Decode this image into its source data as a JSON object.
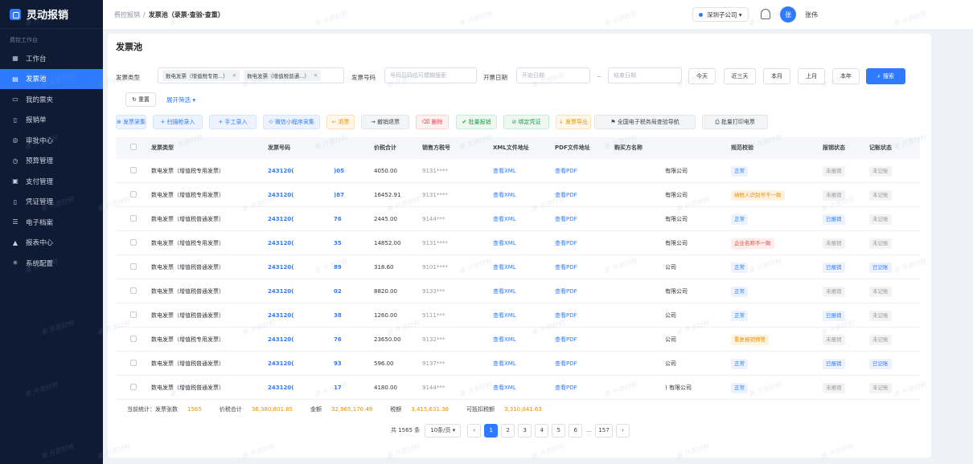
{
  "sidebar": {
    "brand": "灵动报销",
    "section": "费控工作台",
    "items": [
      {
        "icon": "▦",
        "label": "工作台"
      },
      {
        "icon": "▤",
        "label": "发票池"
      },
      {
        "icon": "▭",
        "label": "我的票夹"
      },
      {
        "icon": "▯",
        "label": "报销单"
      },
      {
        "icon": "◎",
        "label": "审批中心"
      },
      {
        "icon": "◷",
        "label": "预算管理"
      },
      {
        "icon": "▣",
        "label": "支付管理"
      },
      {
        "icon": "▯",
        "label": "凭证管理"
      },
      {
        "icon": "☰",
        "label": "电子档案"
      },
      {
        "icon": "▲",
        "label": "报表中心"
      },
      {
        "icon": "✳",
        "label": "系统配置"
      }
    ]
  },
  "header": {
    "crumb_root": "费控报销",
    "crumb_current": "发票池（录票·查验·查重）",
    "company": "深圳子公司 ▾",
    "avatar": "张",
    "user": "张伟"
  },
  "page": {
    "title": "发票池"
  },
  "filters": {
    "type_label": "发票类型",
    "type_tags": [
      "数电发票（增值税专用...）",
      "数电发票（增值税普通...）"
    ],
    "number_label": "发票号码",
    "number_placeholder": "号码后四位可模糊搜索",
    "date_label": "开票日期",
    "date_start": "开始日期",
    "date_sep": "~",
    "date_end": "结束日期",
    "quick": [
      "今天",
      "近三天",
      "本月",
      "上月",
      "本年"
    ],
    "search": "搜索",
    "reset": "重置",
    "expand": "展开筛选 ▾"
  },
  "toolbar": [
    {
      "label": "⊕ 发票采集",
      "style": "blue"
    },
    {
      "label": "+ 扫描枪录入",
      "style": "blue"
    },
    {
      "label": "+ 手工录入",
      "style": "blue"
    },
    {
      "label": "⟐ 微信小程序采集",
      "style": "blue"
    },
    {
      "label": "← 退票",
      "style": "orange"
    },
    {
      "label": "→ 撤销退票",
      "style": "gray"
    },
    {
      "label": "⌫ 删除",
      "style": "red"
    },
    {
      "label": "✔ 批量报销",
      "style": "green"
    },
    {
      "label": "⊘ 绑定凭证",
      "style": "green"
    },
    {
      "label": "↓ 发票导出",
      "style": "orange"
    },
    {
      "label": "⚑ 全国电子税务局查验导航",
      "style": "gray"
    },
    {
      "label": "⎙ 批量打印电票",
      "style": "gray"
    }
  ],
  "table": {
    "headers": [
      "发票类型",
      "发票号码",
      "价税合计",
      "销售方税号",
      "XML文件地址",
      "PDF文件地址",
      "购买方名称",
      "规范校验",
      "报销状态",
      "记账状态"
    ],
    "rows": [
      {
        "type": "数电发票（增值税专用发票）",
        "no_a": "243120(",
        "no_b": ")05",
        "amount": "4050.00",
        "tax_id": "9131****",
        "xml": "查看XML",
        "pdf": "查看PDF",
        "buyer": "有限公司",
        "check": "正常",
        "check_style": "blue",
        "reimb": "未报销",
        "reimb_style": "gray",
        "book": "未记账",
        "book_style": "gray"
      },
      {
        "type": "数电发票（增值税专用发票）",
        "no_a": "243120(",
        "no_b": ")87",
        "amount": "16452.91",
        "tax_id": "9131****",
        "xml": "查看XML",
        "pdf": "查看PDF",
        "buyer": "有限公司",
        "check": "纳税人识别号不一致",
        "check_style": "orange",
        "reimb": "未报销",
        "reimb_style": "gray",
        "book": "未记账",
        "book_style": "gray"
      },
      {
        "type": "数电发票（增值税普通发票）",
        "no_a": "243120(",
        "no_b": "76",
        "amount": "2445.00",
        "tax_id": "9144***",
        "xml": "查看XML",
        "pdf": "查看PDF",
        "buyer": "有限公司",
        "check": "正常",
        "check_style": "blue",
        "reimb": "已报销",
        "reimb_style": "blue",
        "book": "未记账",
        "book_style": "gray"
      },
      {
        "type": "数电发票（增值税专用发票）",
        "no_a": "243120(",
        "no_b": "35",
        "amount": "14852.00",
        "tax_id": "9131****",
        "xml": "查看XML",
        "pdf": "查看PDF",
        "buyer": "有限公司",
        "check": "企业名称不一致",
        "check_style": "red",
        "reimb": "未报销",
        "reimb_style": "gray",
        "book": "未记账",
        "book_style": "gray"
      },
      {
        "type": "数电发票（增值税普通发票）",
        "no_a": "243120(",
        "no_b": "89",
        "amount": "318.60",
        "tax_id": "9101****",
        "xml": "查看XML",
        "pdf": "查看PDF",
        "buyer": "公司",
        "check": "正常",
        "check_style": "blue",
        "reimb": "已报销",
        "reimb_style": "blue",
        "book": "已记账",
        "book_style": "blue"
      },
      {
        "type": "数电发票（增值税普通发票）",
        "no_a": "243120(",
        "no_b": "02",
        "amount": "8820.00",
        "tax_id": "9133***",
        "xml": "查看XML",
        "pdf": "查看PDF",
        "buyer": "有限公司",
        "check": "正常",
        "check_style": "blue",
        "reimb": "未报销",
        "reimb_style": "gray",
        "book": "未记账",
        "book_style": "gray"
      },
      {
        "type": "数电发票（增值税普通发票）",
        "no_a": "243120(",
        "no_b": "38",
        "amount": "1260.00",
        "tax_id": "9111***",
        "xml": "查看XML",
        "pdf": "查看PDF",
        "buyer": "公司",
        "check": "正常",
        "check_style": "blue",
        "reimb": "已报销",
        "reimb_style": "blue",
        "book": "未记账",
        "book_style": "gray"
      },
      {
        "type": "数电发票（增值税专用发票）",
        "no_a": "243120(",
        "no_b": "76",
        "amount": "23650.00",
        "tax_id": "9132***",
        "xml": "查看XML",
        "pdf": "查看PDF",
        "buyer": "公司",
        "check": "重复报销预警",
        "check_style": "orange",
        "reimb": "未报销",
        "reimb_style": "gray",
        "book": "未记账",
        "book_style": "gray"
      },
      {
        "type": "数电发票（增值税普通发票）",
        "no_a": "243120(",
        "no_b": "93",
        "amount": "596.00",
        "tax_id": "9137***",
        "xml": "查看XML",
        "pdf": "查看PDF",
        "buyer": "公司",
        "check": "正常",
        "check_style": "blue",
        "reimb": "已报销",
        "reimb_style": "blue",
        "book": "已记账",
        "book_style": "blue"
      },
      {
        "type": "数电发票（增值税普通发票）",
        "no_a": "243120(",
        "no_b": "17",
        "amount": "4180.00",
        "tax_id": "9144***",
        "xml": "查看XML",
        "pdf": "查看PDF",
        "buyer": ") 有限公司",
        "check": "正常",
        "check_style": "blue",
        "reimb": "未报销",
        "reimb_style": "gray",
        "book": "未记账",
        "book_style": "gray"
      }
    ]
  },
  "summary": {
    "label": "当前统计：发票张数",
    "count": "1565",
    "total_label": "价税合计",
    "total": "36,380,801.85",
    "amount_label": "金额",
    "amount": "32,965,170.49",
    "tax_label": "税额",
    "tax": "3,415,631.36",
    "deduct_label": "可抵扣税额",
    "deduct": "3,310,041.63"
  },
  "pagination": {
    "total": "共 1565 条",
    "page_size": "10条/页 ▾",
    "prev": "‹",
    "pages": [
      "1",
      "2",
      "3",
      "4",
      "5",
      "6"
    ],
    "ellipsis": "...",
    "last": "157",
    "next": "›"
  },
  "watermark": "乘 开票财税"
}
